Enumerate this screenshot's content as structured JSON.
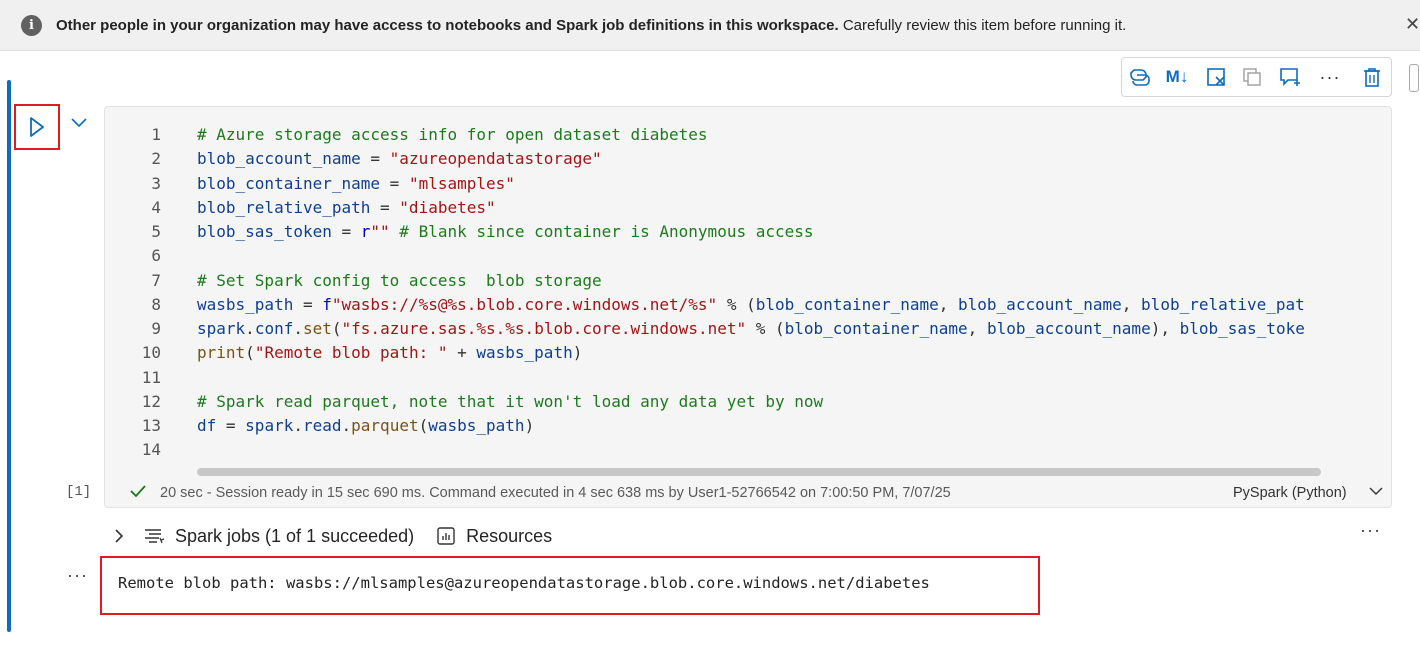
{
  "banner": {
    "bold_text": "Other people in your organization may have access to notebooks and Spark job definitions in this workspace.",
    "normal_text": " Carefully review this item before running it.",
    "info_glyph": "i",
    "close_glyph": "✕"
  },
  "toolbar": {
    "markdown_label": "M↓",
    "more_label": "···",
    "icons": [
      "copilot-icon",
      "markdown-icon",
      "clear-output-icon",
      "duplicate-cell-icon",
      "add-comment-icon",
      "more-icon",
      "delete-icon"
    ]
  },
  "cell": {
    "execution_count": "[1]",
    "code_lines": [
      {
        "n": "1",
        "tokens": [
          {
            "t": "# Azure storage access info for open dataset diabetes",
            "c": "comment"
          }
        ]
      },
      {
        "n": "2",
        "tokens": [
          {
            "t": "blob_account_name",
            "c": "var"
          },
          {
            "t": " = ",
            "c": "op"
          },
          {
            "t": "\"azureopendatastorage\"",
            "c": "str"
          }
        ]
      },
      {
        "n": "3",
        "tokens": [
          {
            "t": "blob_container_name",
            "c": "var"
          },
          {
            "t": " = ",
            "c": "op"
          },
          {
            "t": "\"mlsamples\"",
            "c": "str"
          }
        ]
      },
      {
        "n": "4",
        "tokens": [
          {
            "t": "blob_relative_path",
            "c": "var"
          },
          {
            "t": " = ",
            "c": "op"
          },
          {
            "t": "\"diabetes\"",
            "c": "str"
          }
        ]
      },
      {
        "n": "5",
        "tokens": [
          {
            "t": "blob_sas_token",
            "c": "var"
          },
          {
            "t": " = ",
            "c": "op"
          },
          {
            "t": "r",
            "c": "kw"
          },
          {
            "t": "\"\"",
            "c": "str"
          },
          {
            "t": " # Blank since container is Anonymous access",
            "c": "comment"
          }
        ]
      },
      {
        "n": "6",
        "tokens": []
      },
      {
        "n": "7",
        "tokens": [
          {
            "t": "# Set Spark config to access  blob storage",
            "c": "comment"
          }
        ]
      },
      {
        "n": "8",
        "tokens": [
          {
            "t": "wasbs_path",
            "c": "var"
          },
          {
            "t": " = ",
            "c": "op"
          },
          {
            "t": "f",
            "c": "kw"
          },
          {
            "t": "\"wasbs://%s@%s.blob.core.windows.net/%s\"",
            "c": "str"
          },
          {
            "t": " % (",
            "c": "op"
          },
          {
            "t": "blob_container_name",
            "c": "var"
          },
          {
            "t": ", ",
            "c": "op"
          },
          {
            "t": "blob_account_name",
            "c": "var"
          },
          {
            "t": ", ",
            "c": "op"
          },
          {
            "t": "blob_relative_pat",
            "c": "var"
          }
        ]
      },
      {
        "n": "9",
        "tokens": [
          {
            "t": "spark",
            "c": "var"
          },
          {
            "t": ".",
            "c": "op"
          },
          {
            "t": "conf",
            "c": "var"
          },
          {
            "t": ".",
            "c": "op"
          },
          {
            "t": "set",
            "c": "fn"
          },
          {
            "t": "(",
            "c": "op"
          },
          {
            "t": "\"fs.azure.sas.%s.%s.blob.core.windows.net\"",
            "c": "str"
          },
          {
            "t": " % (",
            "c": "op"
          },
          {
            "t": "blob_container_name",
            "c": "var"
          },
          {
            "t": ", ",
            "c": "op"
          },
          {
            "t": "blob_account_name",
            "c": "var"
          },
          {
            "t": "), ",
            "c": "op"
          },
          {
            "t": "blob_sas_toke",
            "c": "var"
          }
        ]
      },
      {
        "n": "10",
        "tokens": [
          {
            "t": "print",
            "c": "fn"
          },
          {
            "t": "(",
            "c": "op"
          },
          {
            "t": "\"Remote blob path: \"",
            "c": "str"
          },
          {
            "t": " + ",
            "c": "op"
          },
          {
            "t": "wasbs_path",
            "c": "var"
          },
          {
            "t": ")",
            "c": "op"
          }
        ]
      },
      {
        "n": "11",
        "tokens": []
      },
      {
        "n": "12",
        "tokens": [
          {
            "t": "# Spark read parquet, note that it won't load any data yet by now",
            "c": "comment"
          }
        ]
      },
      {
        "n": "13",
        "tokens": [
          {
            "t": "df",
            "c": "var"
          },
          {
            "t": " = ",
            "c": "op"
          },
          {
            "t": "spark",
            "c": "var"
          },
          {
            "t": ".",
            "c": "op"
          },
          {
            "t": "read",
            "c": "var"
          },
          {
            "t": ".",
            "c": "op"
          },
          {
            "t": "parquet",
            "c": "fn"
          },
          {
            "t": "(",
            "c": "op"
          },
          {
            "t": "wasbs_path",
            "c": "var"
          },
          {
            "t": ")",
            "c": "op"
          }
        ]
      },
      {
        "n": "14",
        "tokens": []
      }
    ],
    "status_text": "20 sec - Session ready in 15 sec 690 ms. Command executed in 4 sec 638 ms by User1-52766542 on 7:00:50 PM, 7/07/25",
    "language": "PySpark (Python)"
  },
  "jobs": {
    "spark_jobs_label": "Spark jobs (1 of 1 succeeded)",
    "resources_label": "Resources",
    "more_label": "···"
  },
  "output": {
    "more_label": "···",
    "text": "Remote blob path: wasbs://mlsamples@azureopendatastorage.blob.core.windows.net/diabetes"
  },
  "colors": {
    "accent": "#0f6cbd",
    "highlight_border": "#e01b22",
    "success": "#107c10",
    "comment": "#1c7b1c",
    "string": "#a31515",
    "variable": "#0f3f8f"
  }
}
